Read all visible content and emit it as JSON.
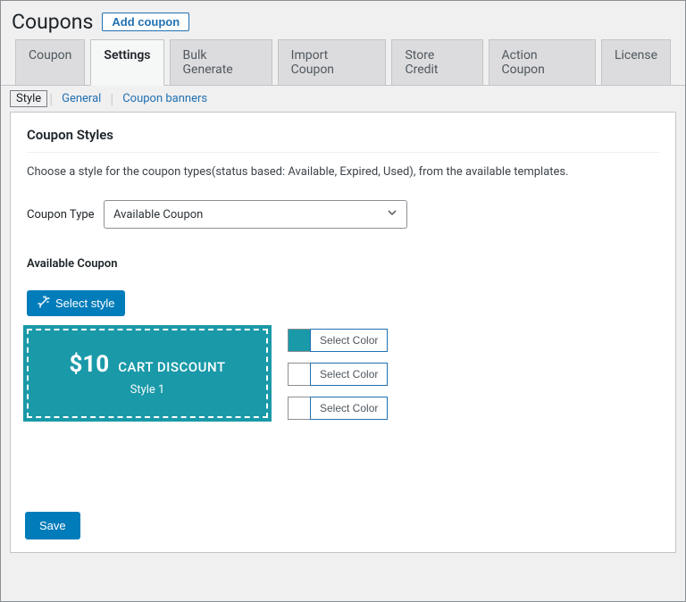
{
  "header": {
    "title": "Coupons",
    "add_label": "Add coupon"
  },
  "tabs": [
    "Coupon",
    "Settings",
    "Bulk Generate",
    "Import Coupon",
    "Store Credit",
    "Action Coupon",
    "License"
  ],
  "subnav": {
    "style": "Style",
    "general": "General",
    "banners": "Coupon banners"
  },
  "panel": {
    "title": "Coupon Styles",
    "description": "Choose a style for the coupon types(status based: Available, Expired, Used), from the available templates.",
    "coupon_type_label": "Coupon Type",
    "coupon_type_value": "Available Coupon",
    "section_heading": "Available Coupon",
    "select_style": "Select style",
    "preview": {
      "amount": "$10",
      "label": "CART DISCOUNT",
      "style": "Style 1"
    },
    "color_btn": "Select Color",
    "save": "Save"
  },
  "colors": {
    "c1": "#1a99a9",
    "c2": "#ffffff",
    "c3": "#ffffff"
  }
}
